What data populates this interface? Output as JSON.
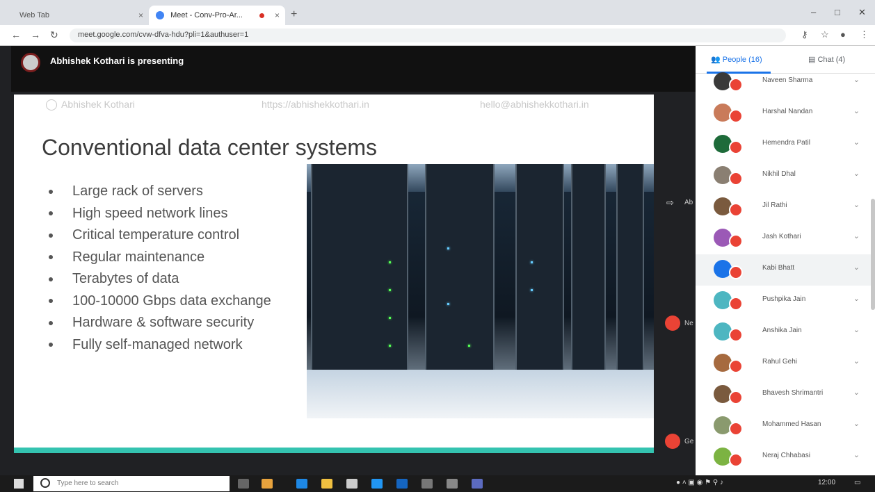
{
  "browser": {
    "tabs": [
      {
        "label": "Web Tab"
      },
      {
        "label": "Meet - Conv-Pro-Ar..."
      }
    ],
    "new_tab": "+",
    "url": "meet.google.com/cvw-dfva-hdu?pli=1&authuser=1",
    "window_controls": {
      "minimize": "–",
      "maximize": "□",
      "close": "✕"
    },
    "nav": {
      "back": "←",
      "forward": "→",
      "reload": "↻"
    }
  },
  "meet": {
    "presenter_text": "Abhishek Kothari is presenting",
    "panel_tabs": [
      {
        "label": "People (16)"
      },
      {
        "label": "Chat (4)"
      }
    ],
    "participants": [
      {
        "name": "Naveen Sharma",
        "avatar_color": "#3a3a3a"
      },
      {
        "name": "Harshal Nandan",
        "avatar_color": "#c97b5a"
      },
      {
        "name": "Hemendra Patil",
        "avatar_color": "#1e6b3a"
      },
      {
        "name": "Nikhil Dhal",
        "avatar_color": "#8a7f72"
      },
      {
        "name": "Jil Rathi",
        "avatar_color": "#7a5a3e"
      },
      {
        "name": "Jash Kothari",
        "avatar_color": "#9b59b6"
      },
      {
        "name": "Kabi Bhatt",
        "avatar_color": "#1a73e8"
      },
      {
        "name": "Pushpika Jain",
        "avatar_color": "#4db6c1"
      },
      {
        "name": "Anshika Jain",
        "avatar_color": "#4db6c1"
      },
      {
        "name": "Rahul Gehi",
        "avatar_color": "#a66a3f"
      },
      {
        "name": "Bhavesh Shrimantri",
        "avatar_color": "#7a5a3e"
      },
      {
        "name": "Mohammed Hasan",
        "avatar_color": "#8a9a6e"
      },
      {
        "name": "Neraj Chhabasi",
        "avatar_color": "#7cb342"
      }
    ],
    "side_labels": [
      "Ab",
      "Ne",
      "Ge"
    ]
  },
  "slide": {
    "header_left": "Abhishek Kothari",
    "header_mid": "https://abhishekkothari.in",
    "header_right": "hello@abhishekkothari.in",
    "title": "Conventional data center systems",
    "bullets": [
      "Large rack of servers",
      "High speed network lines",
      "Critical temperature control",
      "Regular maintenance",
      "Terabytes of data",
      "100-10000 Gbps data exchange",
      "Hardware & software security",
      "Fully self-managed network"
    ],
    "accent_color": "#34c3b0"
  },
  "taskbar": {
    "search_placeholder": "Type here to search",
    "clock": "12:00"
  }
}
